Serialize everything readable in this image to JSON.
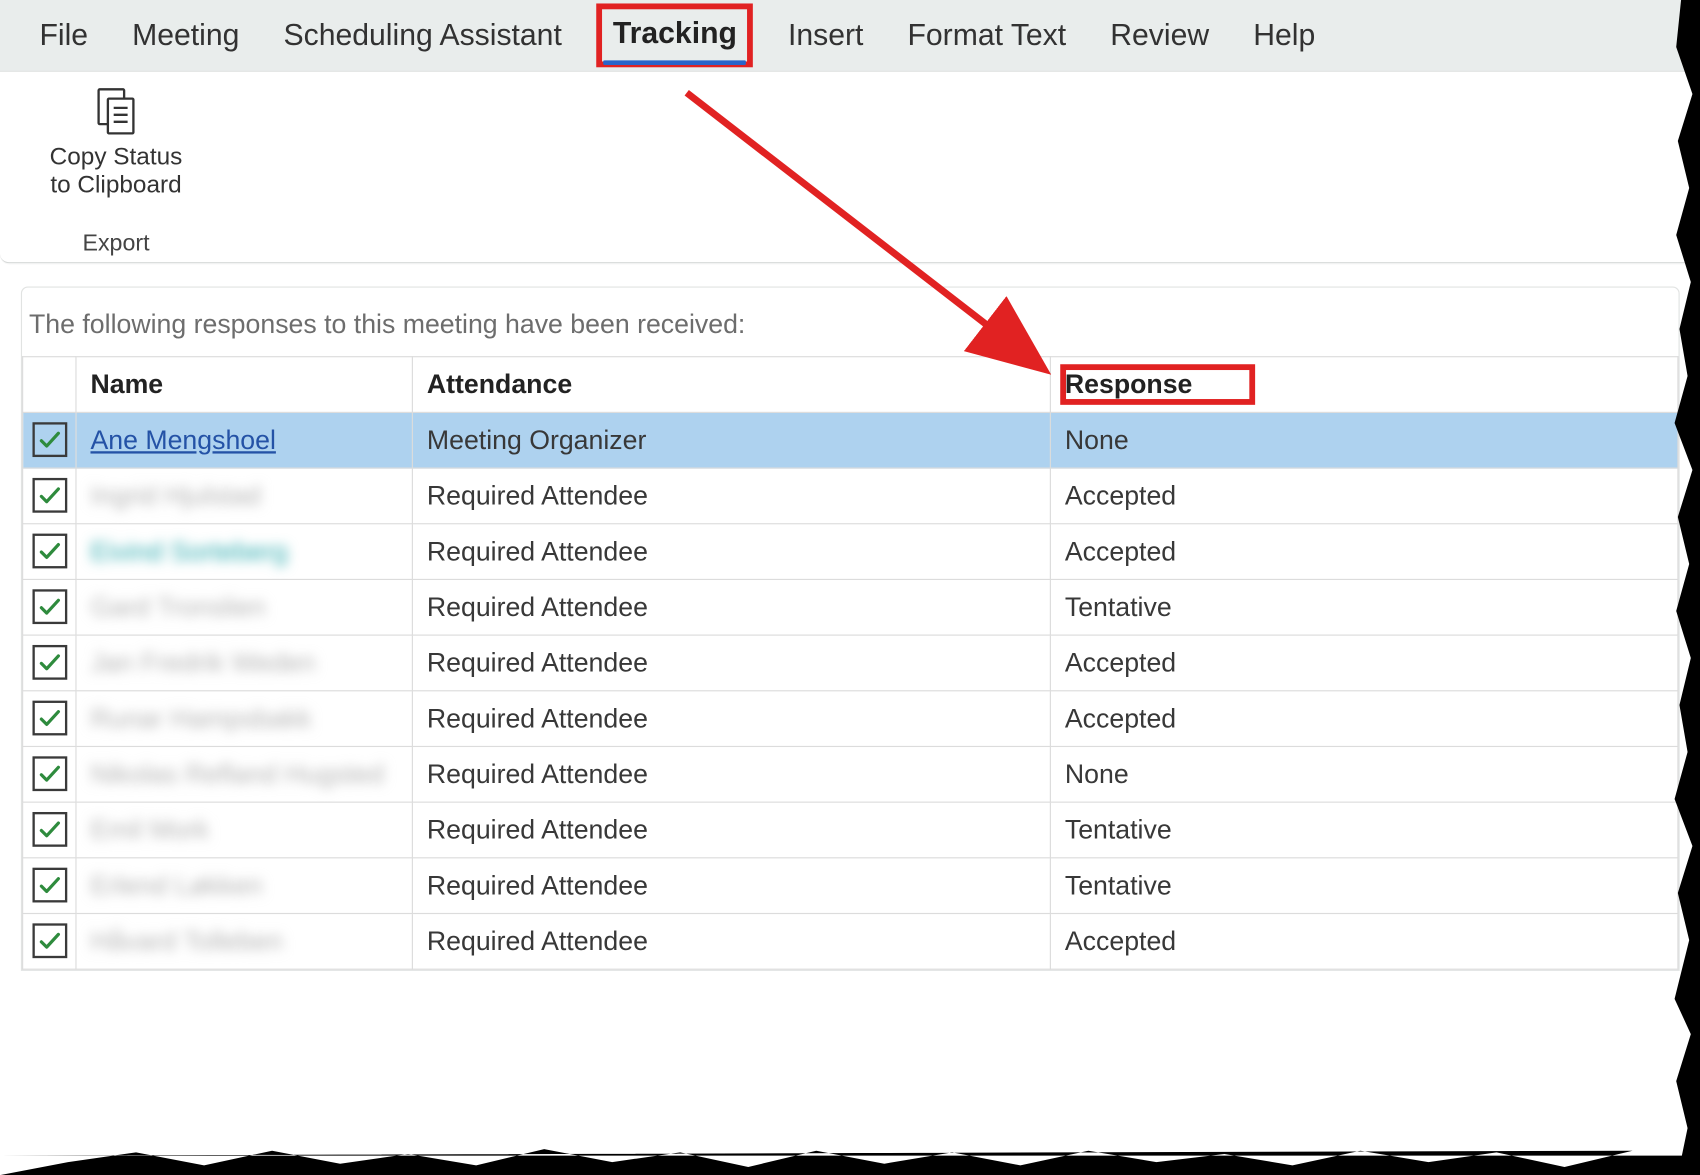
{
  "menu": {
    "items": [
      {
        "label": "File",
        "active": false
      },
      {
        "label": "Meeting",
        "active": false
      },
      {
        "label": "Scheduling Assistant",
        "active": false
      },
      {
        "label": "Tracking",
        "active": true
      },
      {
        "label": "Insert",
        "active": false
      },
      {
        "label": "Format Text",
        "active": false
      },
      {
        "label": "Review",
        "active": false
      },
      {
        "label": "Help",
        "active": false
      }
    ]
  },
  "ribbon": {
    "copy_status_line1": "Copy Status",
    "copy_status_line2": "to Clipboard",
    "group_name": "Export"
  },
  "responses_caption": "The following responses to this meeting have been received:",
  "table": {
    "headers": {
      "name": "Name",
      "attendance": "Attendance",
      "response": "Response"
    },
    "rows": [
      {
        "checked": true,
        "name": "Ane Mengshoel",
        "name_style": "link",
        "attendance": "Meeting Organizer",
        "response": "None",
        "selected": true
      },
      {
        "checked": true,
        "name": "Ingrid Hjulstad",
        "name_style": "blur",
        "attendance": "Required Attendee",
        "response": "Accepted",
        "selected": false
      },
      {
        "checked": true,
        "name": "Eivind Sorteberg",
        "name_style": "blur-teal",
        "attendance": "Required Attendee",
        "response": "Accepted",
        "selected": false
      },
      {
        "checked": true,
        "name": "Gard Tronslien",
        "name_style": "blur",
        "attendance": "Required Attendee",
        "response": "Tentative",
        "selected": false
      },
      {
        "checked": true,
        "name": "Jan Fredrik Weden",
        "name_style": "blur",
        "attendance": "Required Attendee",
        "response": "Accepted",
        "selected": false
      },
      {
        "checked": true,
        "name": "Runar Hampsbakk",
        "name_style": "blur",
        "attendance": "Required Attendee",
        "response": "Accepted",
        "selected": false
      },
      {
        "checked": true,
        "name": "Nikolas Refland Hugsted",
        "name_style": "blur",
        "attendance": "Required Attendee",
        "response": "None",
        "selected": false
      },
      {
        "checked": true,
        "name": "Emil Mork",
        "name_style": "blur",
        "attendance": "Required Attendee",
        "response": "Tentative",
        "selected": false
      },
      {
        "checked": true,
        "name": "Erlend Løkken",
        "name_style": "blur",
        "attendance": "Required Attendee",
        "response": "Tentative",
        "selected": false
      },
      {
        "checked": true,
        "name": "Håvard Tolleben",
        "name_style": "blur",
        "attendance": "Required Attendee",
        "response": "Accepted",
        "selected": false
      }
    ]
  },
  "annotations": {
    "highlight_tab": "Tracking",
    "highlight_column": "Response",
    "arrow_color": "#e12222"
  }
}
